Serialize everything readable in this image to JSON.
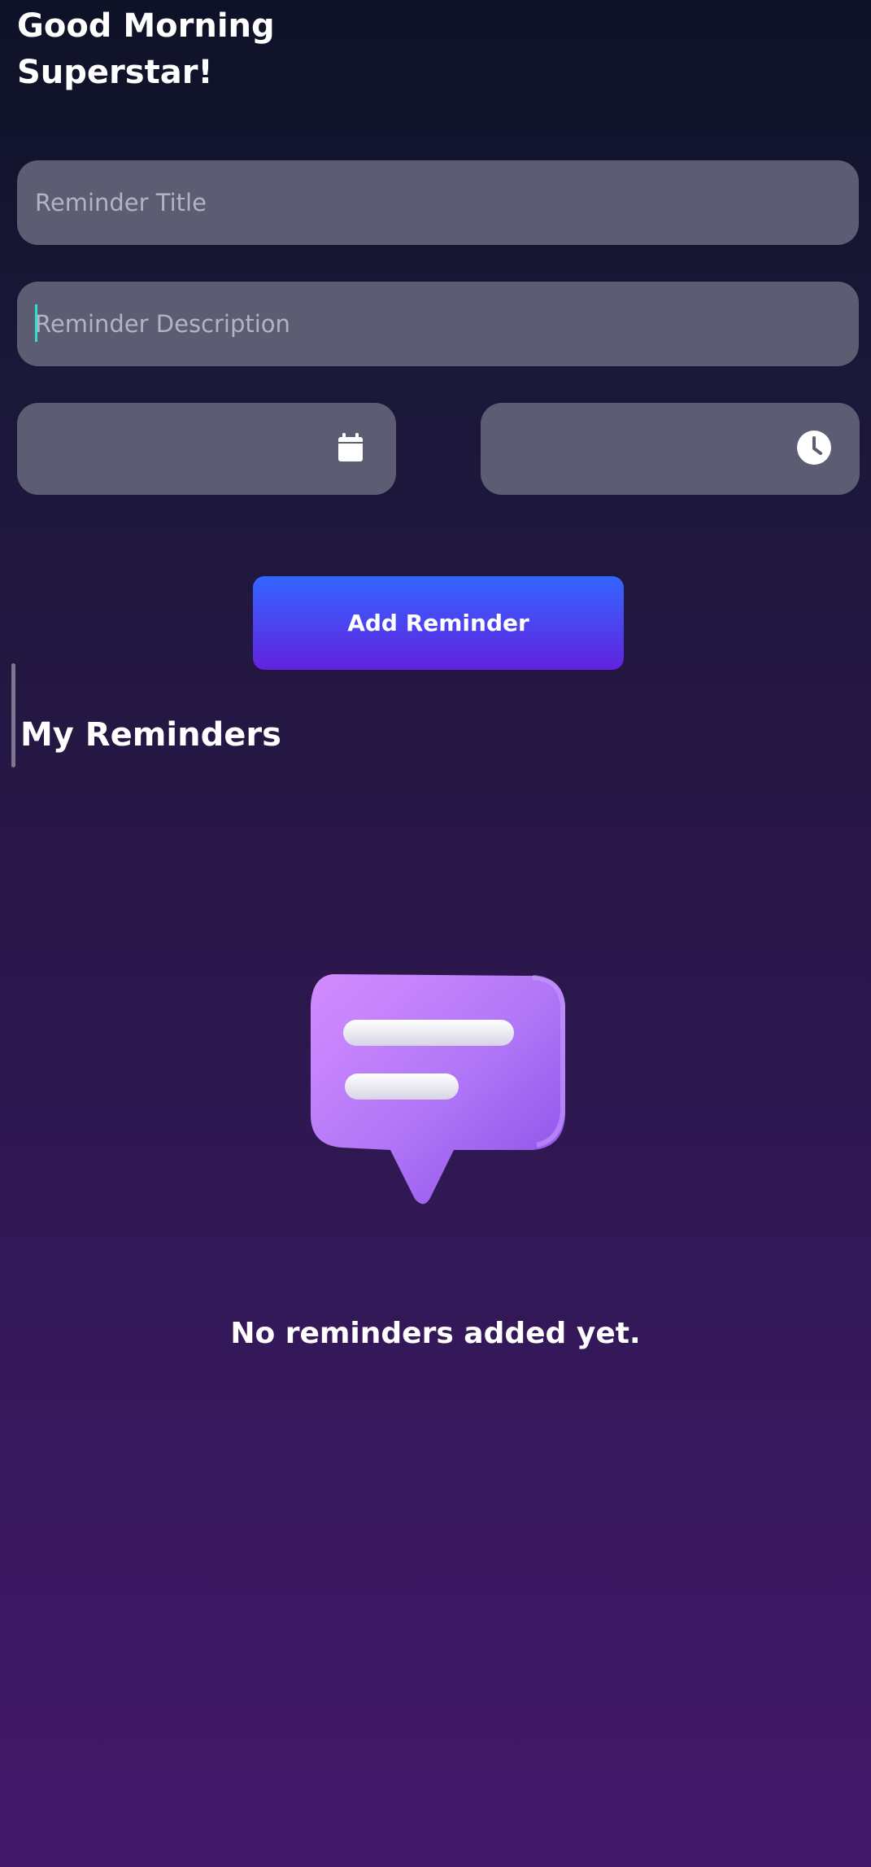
{
  "header": {
    "greeting_line1": "Good Morning",
    "greeting_line2": "Superstar!"
  },
  "form": {
    "title_placeholder": "Reminder Title",
    "title_value": "",
    "description_placeholder": "Reminder Description",
    "description_value": "",
    "date_value": "",
    "time_value": "",
    "date_icon": "calendar-icon",
    "time_icon": "clock-icon",
    "add_button_label": "Add Reminder"
  },
  "reminders": {
    "section_title": "My Reminders",
    "empty_illustration": "chat-bubble-illustration",
    "empty_message": "No reminders added yet.",
    "items": []
  },
  "colors": {
    "field_background": "#5c5c72",
    "button_gradient_top": "#3366ff",
    "button_gradient_bottom": "#6222e0",
    "caret": "#2ee0d0",
    "accent_purple": "#a66cf5"
  }
}
